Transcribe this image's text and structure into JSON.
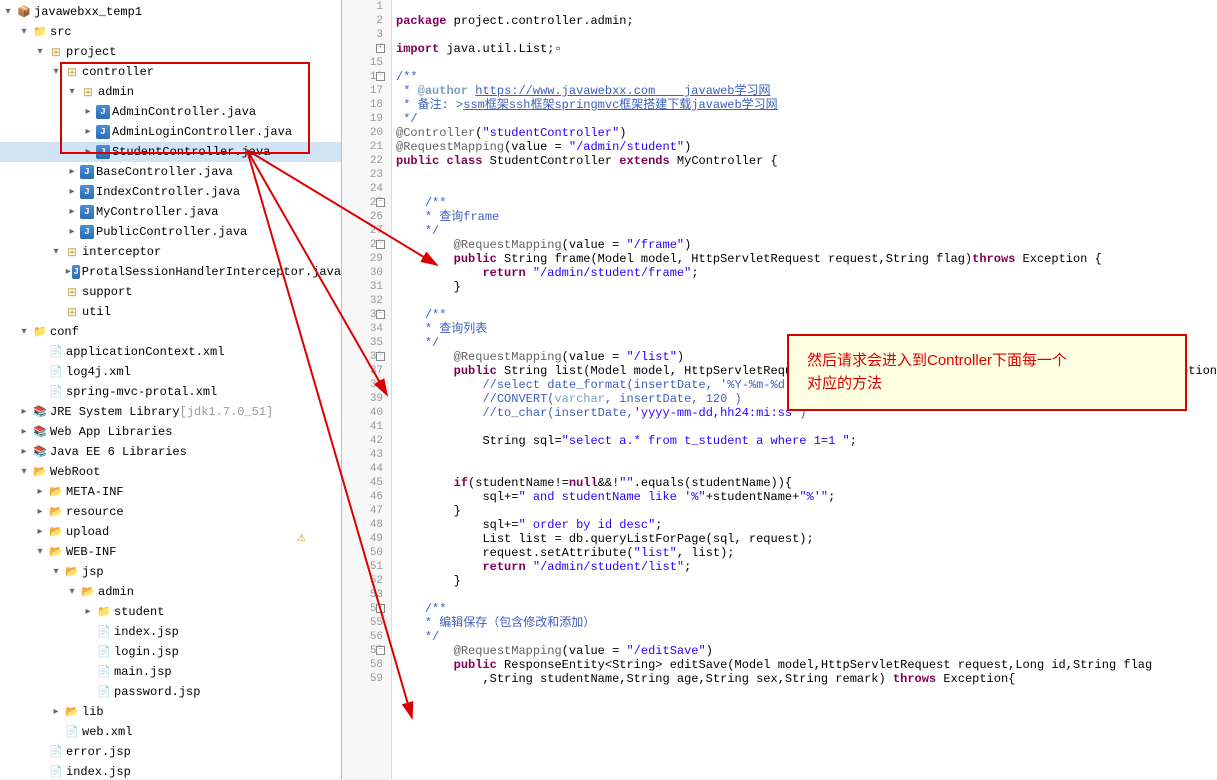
{
  "tree": {
    "root": "javawebxx_temp1",
    "items": [
      {
        "level": 0,
        "toggle": "▾",
        "icon": "project",
        "label": "javawebxx_temp1"
      },
      {
        "level": 1,
        "toggle": "▾",
        "icon": "src",
        "label": "src"
      },
      {
        "level": 2,
        "toggle": "▾",
        "icon": "package",
        "label": "project"
      },
      {
        "level": 3,
        "toggle": "▾",
        "icon": "package",
        "label": "controller"
      },
      {
        "level": 4,
        "toggle": "▾",
        "icon": "package",
        "label": "admin"
      },
      {
        "level": 5,
        "toggle": "▸",
        "icon": "java",
        "label": "AdminController.java"
      },
      {
        "level": 5,
        "toggle": "▸",
        "icon": "java",
        "label": "AdminLoginController.java"
      },
      {
        "level": 5,
        "toggle": "▸",
        "icon": "java",
        "label": "StudentController.java",
        "selected": true
      },
      {
        "level": 4,
        "toggle": "▸",
        "icon": "java",
        "label": "BaseController.java"
      },
      {
        "level": 4,
        "toggle": "▸",
        "icon": "java",
        "label": "IndexController.java"
      },
      {
        "level": 4,
        "toggle": "▸",
        "icon": "java",
        "label": "MyController.java"
      },
      {
        "level": 4,
        "toggle": "▸",
        "icon": "java",
        "label": "PublicController.java"
      },
      {
        "level": 3,
        "toggle": "▾",
        "icon": "package",
        "label": "interceptor"
      },
      {
        "level": 4,
        "toggle": "▸",
        "icon": "java",
        "label": "ProtalSessionHandlerInterceptor.java"
      },
      {
        "level": 3,
        "toggle": "",
        "icon": "package",
        "label": "support"
      },
      {
        "level": 3,
        "toggle": "",
        "icon": "package",
        "label": "util"
      },
      {
        "level": 1,
        "toggle": "▾",
        "icon": "src",
        "label": "conf"
      },
      {
        "level": 2,
        "toggle": "",
        "icon": "xml",
        "label": "applicationContext.xml"
      },
      {
        "level": 2,
        "toggle": "",
        "icon": "xml",
        "label": "log4j.xml"
      },
      {
        "level": 2,
        "toggle": "",
        "icon": "xml",
        "label": "spring-mvc-protal.xml"
      },
      {
        "level": 1,
        "toggle": "▸",
        "icon": "lib",
        "label": "JRE System Library",
        "suffix": "[jdk1.7.0_51]"
      },
      {
        "level": 1,
        "toggle": "▸",
        "icon": "lib",
        "label": "Web App Libraries"
      },
      {
        "level": 1,
        "toggle": "▸",
        "icon": "lib",
        "label": "Java EE 6 Libraries"
      },
      {
        "level": 1,
        "toggle": "▾",
        "icon": "folder",
        "label": "WebRoot"
      },
      {
        "level": 2,
        "toggle": "▸",
        "icon": "folder",
        "label": "META-INF"
      },
      {
        "level": 2,
        "toggle": "▸",
        "icon": "folder",
        "label": "resource"
      },
      {
        "level": 2,
        "toggle": "▸",
        "icon": "folder",
        "label": "upload"
      },
      {
        "level": 2,
        "toggle": "▾",
        "icon": "folder",
        "label": "WEB-INF"
      },
      {
        "level": 3,
        "toggle": "▾",
        "icon": "folder",
        "label": "jsp"
      },
      {
        "level": 4,
        "toggle": "▾",
        "icon": "folder",
        "label": "admin"
      },
      {
        "level": 5,
        "toggle": "▸",
        "icon": "folder-closed",
        "label": "student"
      },
      {
        "level": 5,
        "toggle": "",
        "icon": "jsp",
        "label": "index.jsp"
      },
      {
        "level": 5,
        "toggle": "",
        "icon": "jsp",
        "label": "login.jsp"
      },
      {
        "level": 5,
        "toggle": "",
        "icon": "jsp",
        "label": "main.jsp"
      },
      {
        "level": 5,
        "toggle": "",
        "icon": "jsp",
        "label": "password.jsp"
      },
      {
        "level": 3,
        "toggle": "▸",
        "icon": "folder",
        "label": "lib"
      },
      {
        "level": 3,
        "toggle": "",
        "icon": "xml",
        "label": "web.xml"
      },
      {
        "level": 2,
        "toggle": "",
        "icon": "jsp",
        "label": "error.jsp"
      },
      {
        "level": 2,
        "toggle": "",
        "icon": "jsp",
        "label": "index.jsp"
      }
    ]
  },
  "code": {
    "lines": [
      {
        "n": 1,
        "html": ""
      },
      {
        "n": 2,
        "html": "<span class='kw'>package</span> project.controller.admin;"
      },
      {
        "n": 3,
        "html": ""
      },
      {
        "n": 4,
        "html": "<span class='kw'>import</span> java.util.List;▫",
        "fold": "+"
      },
      {
        "n": 15,
        "html": ""
      },
      {
        "n": 16,
        "html": "<span class='com'>/**</span>",
        "fold": "-"
      },
      {
        "n": 17,
        "html": "<span class='com'> * </span><span class='todo'>@author</span><span class='com'> </span><span class='link'>https://www.javawebxx.com    javaweb学习网</span>"
      },
      {
        "n": 18,
        "html": "<span class='com'> * 备注: &gt;</span><span class='link'>ssm框架ssh框架springmvc框架搭建下载javaweb学习网</span>"
      },
      {
        "n": 19,
        "html": "<span class='com'> */</span>"
      },
      {
        "n": 20,
        "html": "<span class='ann'>@Controller</span>(<span class='str'>\"studentController\"</span>)"
      },
      {
        "n": 21,
        "html": "<span class='ann'>@RequestMapping</span>(value = <span class='str'>\"/admin/student\"</span>)"
      },
      {
        "n": 22,
        "html": "<span class='kw'>public</span> <span class='kw'>class</span> StudentController <span class='kw'>extends</span> MyController {"
      },
      {
        "n": 23,
        "html": ""
      },
      {
        "n": 24,
        "html": ""
      },
      {
        "n": 25,
        "html": "    <span class='com'>/**</span>",
        "fold": "-"
      },
      {
        "n": 26,
        "html": "<span class='com'>    * 查询frame</span>"
      },
      {
        "n": 27,
        "html": "<span class='com'>    */</span>"
      },
      {
        "n": 28,
        "html": "        <span class='ann'>@RequestMapping</span>(value = <span class='str'>\"/frame\"</span>)",
        "fold": "-"
      },
      {
        "n": 29,
        "html": "        <span class='kw'>public</span> String frame(Model model, HttpServletRequest request,String flag)<span class='kw'>throws</span> Exception {"
      },
      {
        "n": 30,
        "html": "            <span class='kw'>return</span> <span class='str'>\"/admin/student/frame\"</span>;"
      },
      {
        "n": 31,
        "html": "        }"
      },
      {
        "n": 32,
        "html": ""
      },
      {
        "n": 33,
        "html": "    <span class='com'>/**</span>",
        "fold": "-"
      },
      {
        "n": 34,
        "html": "<span class='com'>    * 查询列表</span>"
      },
      {
        "n": 35,
        "html": "<span class='com'>    */</span>"
      },
      {
        "n": 36,
        "html": "        <span class='ann'>@RequestMapping</span>(value = <span class='str'>\"/list\"</span>)",
        "fold": "-"
      },
      {
        "n": 37,
        "html": "        <span class='kw'>public</span> String list(Model model, HttpServletRequest request,String flag,String studentName)<span class='kw'>throws</span> Exception"
      },
      {
        "n": 38,
        "html": "            <span class='com'>//select date_format(insertDate, '%Y-%m-%d %H:%i:%s')</span>"
      },
      {
        "n": 39,
        "html": "            <span class='com'>//CONVERT(</span><span class='cn'>varchar</span><span class='com'>, insertDate, 120 )</span>"
      },
      {
        "n": 40,
        "html": "            <span class='com'>//to_char(insertDate,</span><span class='str'>'yyyy-mm-dd,hh24:mi:ss'</span><span class='com'>)</span>"
      },
      {
        "n": 41,
        "html": ""
      },
      {
        "n": 42,
        "html": "            String sql=<span class='str'>\"select a.* from t_student a where 1=1 \"</span>;"
      },
      {
        "n": 43,
        "html": ""
      },
      {
        "n": 44,
        "html": ""
      },
      {
        "n": 45,
        "html": "        <span class='kw'>if</span>(studentName!=<span class='kw'>null</span>&&!<span class='str'>\"\"</span>.equals(studentName)){"
      },
      {
        "n": 46,
        "html": "            sql+=<span class='str'>\" and studentName like '%\"</span>+studentName+<span class='str'>\"%'\"</span>;"
      },
      {
        "n": 47,
        "html": "        }"
      },
      {
        "n": 48,
        "html": "            sql+=<span class='str'>\" order by id desc\"</span>;"
      },
      {
        "n": 49,
        "html": "            List list = db.queryListForPage(sql, request);",
        "warn": true
      },
      {
        "n": 50,
        "html": "            request.setAttribute(<span class='str'>\"list\"</span>, list);"
      },
      {
        "n": 51,
        "html": "            <span class='kw'>return</span> <span class='str'>\"/admin/student/list\"</span>;"
      },
      {
        "n": 52,
        "html": "        }"
      },
      {
        "n": 53,
        "html": ""
      },
      {
        "n": 54,
        "html": "    <span class='com'>/**</span>",
        "fold": "-"
      },
      {
        "n": 55,
        "html": "<span class='com'>    * 编辑保存（包含修改和添加）</span>"
      },
      {
        "n": 56,
        "html": "<span class='com'>    */</span>"
      },
      {
        "n": 57,
        "html": "        <span class='ann'>@RequestMapping</span>(value = <span class='str'>\"/editSave\"</span>)",
        "fold": "-"
      },
      {
        "n": 58,
        "html": "        <span class='kw'>public</span> ResponseEntity&lt;String&gt; editSave(Model model,HttpServletRequest request,Long id,String flag"
      },
      {
        "n": 59,
        "html": "            ,String studentName,String age,String sex,String remark) <span class='kw'>throws</span> Exception{"
      }
    ]
  },
  "annotation": {
    "line1": "然后请求会进入到Controller下面每一个",
    "line2": "对应的方法"
  }
}
